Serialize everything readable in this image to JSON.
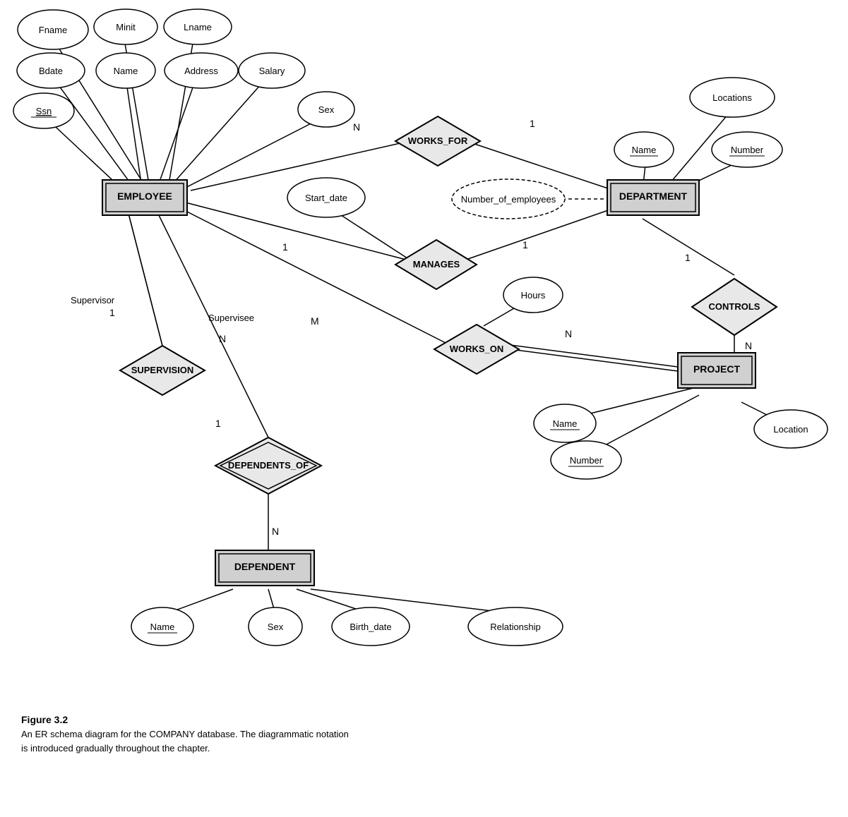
{
  "caption": {
    "title": "Figure 3.2",
    "line1": "An ER schema diagram for the COMPANY database. The diagrammatic notation",
    "line2": "is introduced gradually throughout the chapter."
  },
  "entities": {
    "employee": "EMPLOYEE",
    "department": "DEPARTMENT",
    "project": "PROJECT",
    "dependent": "DEPENDENT"
  },
  "relationships": {
    "works_for": "WORKS_FOR",
    "manages": "MANAGES",
    "controls": "CONTROLS",
    "works_on": "WORKS_ON",
    "supervision": "SUPERVISION",
    "dependents_of": "DEPENDENTS_OF"
  },
  "attributes": {
    "fname": "Fname",
    "minit": "Minit",
    "lname": "Lname",
    "bdate": "Bdate",
    "name_emp": "Name",
    "address": "Address",
    "salary": "Salary",
    "ssn": "Ssn",
    "sex_emp": "Sex",
    "start_date": "Start_date",
    "num_employees": "Number_of_employees",
    "locations": "Locations",
    "dept_name": "Name",
    "dept_number": "Number",
    "hours": "Hours",
    "proj_name": "Name",
    "proj_number": "Number",
    "location": "Location",
    "dep_name": "Name",
    "dep_sex": "Sex",
    "dep_birthdate": "Birth_date",
    "dep_relationship": "Relationship"
  },
  "cardinalities": {
    "n1": "N",
    "n2": "1",
    "n3": "1",
    "n4": "1",
    "m1": "M",
    "m2": "N",
    "m3": "1",
    "m4": "N",
    "s1": "1",
    "s2": "N",
    "dep1": "1",
    "dep2": "N",
    "ctrl1": "1",
    "ctrl2": "N"
  }
}
